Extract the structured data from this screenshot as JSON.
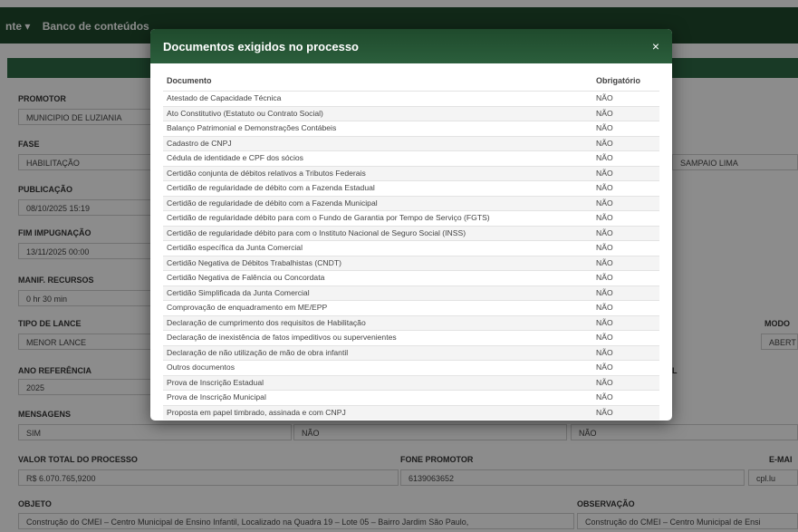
{
  "nav": {
    "items": [
      "nte ▾",
      "Banco de conteúdos"
    ]
  },
  "form": {
    "promotor": {
      "label": "PROMOTOR",
      "value": "MUNICIPIO DE LUZIANIA"
    },
    "fase": {
      "label": "FASE",
      "value": "HABILITAÇÃO"
    },
    "fase_right_value": "SAMPAIO LIMA",
    "publicacao": {
      "label": "PUBLICAÇÃO",
      "value": "08/10/2025 15:19"
    },
    "fim_impugnacao": {
      "label": "FIM IMPUGNAÇÃO",
      "value": "13/11/2025 00:00"
    },
    "manif_recursos": {
      "label": "MANIF. RECURSOS",
      "value": "0 hr 30 min"
    },
    "tipo_lance": {
      "label": "TIPO DE LANCE",
      "value": "MENOR LANCE"
    },
    "modo": {
      "label": "MODO",
      "value": "ABERT"
    },
    "ano_referencia": {
      "label": "ANO REFERÊNCIA",
      "value": "2025"
    },
    "ano_right_label": "L",
    "mensagens": {
      "label": "MENSAGENS",
      "value": "SIM",
      "value2": "NÃO",
      "value3": "NÃO"
    },
    "valor_total": {
      "label": "VALOR TOTAL DO PROCESSO",
      "value": "R$ 6.070.765,9200"
    },
    "fone_promotor": {
      "label": "FONE PROMOTOR",
      "value": "6139063652"
    },
    "email": {
      "label": "E-MAI",
      "value": "cpl.lu"
    },
    "objeto": {
      "label": "OBJETO",
      "value": "Construção do CMEI – Centro Municipal de Ensino Infantil, Localizado na Quadra 19 – Lote 05 – Bairro Jardim São Paulo,"
    },
    "observacao": {
      "label": "OBSERVAÇÃO",
      "value": "Construção do CMEI – Centro Municipal de Ensi"
    }
  },
  "modal": {
    "title": "Documentos exigidos no processo",
    "close": "×",
    "col_documento": "Documento",
    "col_obrigatorio": "Obrigatório",
    "rows": [
      {
        "doc": "Atestado de Capacidade Técnica",
        "req": "NÃO"
      },
      {
        "doc": "Ato Constitutivo (Estatuto ou Contrato Social)",
        "req": "NÃO"
      },
      {
        "doc": "Balanço Patrimonial e Demonstrações Contábeis",
        "req": "NÃO"
      },
      {
        "doc": "Cadastro de CNPJ",
        "req": "NÃO"
      },
      {
        "doc": "Cédula de identidade e CPF dos sócios",
        "req": "NÃO"
      },
      {
        "doc": "Certidão conjunta de débitos relativos a Tributos Federais",
        "req": "NÃO"
      },
      {
        "doc": "Certidão de regularidade de débito com a Fazenda Estadual",
        "req": "NÃO"
      },
      {
        "doc": "Certidão de regularidade de débito com a Fazenda Municipal",
        "req": "NÃO"
      },
      {
        "doc": "Certidão de regularidade débito para com o Fundo de Garantia por Tempo de Serviço (FGTS)",
        "req": "NÃO"
      },
      {
        "doc": "Certidão de regularidade débito para com o Instituto Nacional de Seguro Social (INSS)",
        "req": "NÃO"
      },
      {
        "doc": "Certidão específica da Junta Comercial",
        "req": "NÃO"
      },
      {
        "doc": "Certidão Negativa de Débitos Trabalhistas (CNDT)",
        "req": "NÃO"
      },
      {
        "doc": "Certidão Negativa de Falência ou Concordata",
        "req": "NÃO"
      },
      {
        "doc": "Certidão Simplificada da Junta Comercial",
        "req": "NÃO"
      },
      {
        "doc": "Comprovação de enquadramento em ME/EPP",
        "req": "NÃO"
      },
      {
        "doc": "Declaração de cumprimento dos requisitos de Habilitação",
        "req": "NÃO"
      },
      {
        "doc": "Declaração de inexistência de fatos impeditivos ou supervenientes",
        "req": "NÃO"
      },
      {
        "doc": "Declaração de não utilização de mão de obra infantil",
        "req": "NÃO"
      },
      {
        "doc": "Outros documentos",
        "req": "NÃO"
      },
      {
        "doc": "Prova de Inscrição Estadual",
        "req": "NÃO"
      },
      {
        "doc": "Prova de Inscrição Municipal",
        "req": "NÃO"
      },
      {
        "doc": "Proposta em papel timbrado, assinada e com CNPJ",
        "req": "NÃO"
      }
    ]
  }
}
